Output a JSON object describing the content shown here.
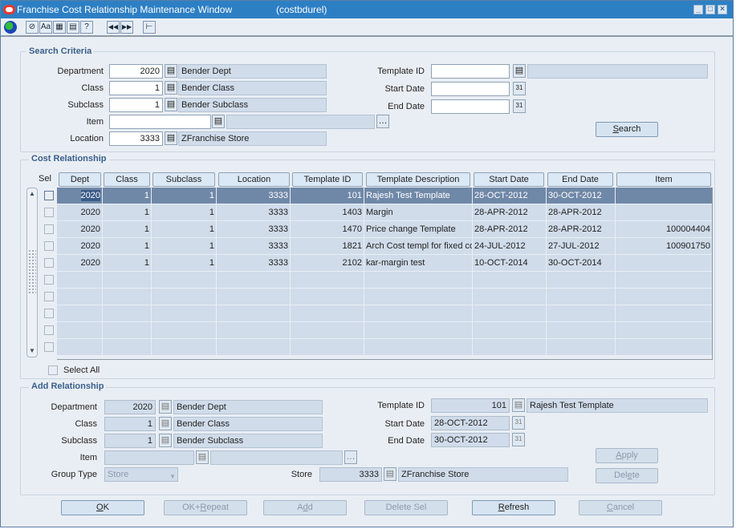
{
  "window": {
    "title": "Franchise Cost Relationship Maintenance Window",
    "module": "(costbdurel)",
    "controls": [
      "minimize",
      "maximize",
      "close"
    ]
  },
  "toolbar": {
    "icons": [
      "globe-icon",
      "exit-icon",
      "text-icon",
      "edit-icon",
      "print-icon",
      "help-icon",
      "previous-icon",
      "next-icon",
      "action-icon"
    ],
    "glyphs": {
      "exit": "⊘",
      "text": "Aa",
      "edit": "▦",
      "print": "▤",
      "help": "?",
      "prev": "◀◀",
      "next": "▶▶",
      "action": "⊢"
    }
  },
  "search_criteria": {
    "title": "Search Criteria",
    "department": {
      "label": "Department",
      "value": "2020",
      "desc": "Bender Dept"
    },
    "class": {
      "label": "Class",
      "value": "1",
      "desc": "Bender Class"
    },
    "subclass": {
      "label": "Subclass",
      "value": "1",
      "desc": "Bender Subclass"
    },
    "item": {
      "label": "Item",
      "value": "",
      "desc": ""
    },
    "location": {
      "label": "Location",
      "value": "3333",
      "desc": "ZFranchise Store"
    },
    "template_id": {
      "label": "Template ID",
      "value": "",
      "desc": ""
    },
    "start_date": {
      "label": "Start Date",
      "value": ""
    },
    "end_date": {
      "label": "End Date",
      "value": ""
    },
    "search_button": {
      "mnemonic": "S",
      "rest": "earch"
    }
  },
  "cost_relationship": {
    "title": "Cost Relationship",
    "sel_header": "Sel",
    "columns": [
      "Dept",
      "Class",
      "Subclass",
      "Location",
      "Template ID",
      "Template Description",
      "Start Date",
      "End Date",
      "Item"
    ],
    "rows": [
      {
        "dept": "2020",
        "class": "1",
        "subclass": "1",
        "location": "3333",
        "template_id": "101",
        "description": "Rajesh Test Template",
        "start": "28-OCT-2012",
        "end": "30-OCT-2012",
        "item": "",
        "selected": true
      },
      {
        "dept": "2020",
        "class": "1",
        "subclass": "1",
        "location": "3333",
        "template_id": "1403",
        "description": "Margin",
        "start": "28-APR-2012",
        "end": "28-APR-2012",
        "item": "",
        "selected": false
      },
      {
        "dept": "2020",
        "class": "1",
        "subclass": "1",
        "location": "3333",
        "template_id": "1470",
        "description": "Price change Template",
        "start": "28-APR-2012",
        "end": "28-APR-2012",
        "item": "100004404",
        "selected": false
      },
      {
        "dept": "2020",
        "class": "1",
        "subclass": "1",
        "location": "3333",
        "template_id": "1821",
        "description": "Arch Cost templ for fixed co",
        "start": "24-JUL-2012",
        "end": "27-JUL-2012",
        "item": "100901750",
        "selected": false
      },
      {
        "dept": "2020",
        "class": "1",
        "subclass": "1",
        "location": "3333",
        "template_id": "2102",
        "description": "kar-margin test",
        "start": "10-OCT-2014",
        "end": "30-OCT-2014",
        "item": "",
        "selected": false
      },
      {
        "dept": "",
        "class": "",
        "subclass": "",
        "location": "",
        "template_id": "",
        "description": "",
        "start": "",
        "end": "",
        "item": "",
        "selected": false
      },
      {
        "dept": "",
        "class": "",
        "subclass": "",
        "location": "",
        "template_id": "",
        "description": "",
        "start": "",
        "end": "",
        "item": "",
        "selected": false
      },
      {
        "dept": "",
        "class": "",
        "subclass": "",
        "location": "",
        "template_id": "",
        "description": "",
        "start": "",
        "end": "",
        "item": "",
        "selected": false
      },
      {
        "dept": "",
        "class": "",
        "subclass": "",
        "location": "",
        "template_id": "",
        "description": "",
        "start": "",
        "end": "",
        "item": "",
        "selected": false
      },
      {
        "dept": "",
        "class": "",
        "subclass": "",
        "location": "",
        "template_id": "",
        "description": "",
        "start": "",
        "end": "",
        "item": "",
        "selected": false
      }
    ],
    "select_all_label": "Select All"
  },
  "add_relationship": {
    "title": "Add Relationship",
    "department": {
      "label": "Department",
      "value": "2020",
      "desc": "Bender Dept"
    },
    "class": {
      "label": "Class",
      "value": "1",
      "desc": "Bender Class"
    },
    "subclass": {
      "label": "Subclass",
      "value": "1",
      "desc": "Bender Subclass"
    },
    "item": {
      "label": "Item",
      "value": "",
      "desc": ""
    },
    "group_type": {
      "label": "Group Type",
      "value": "Store"
    },
    "store": {
      "label": "Store",
      "value": "3333",
      "desc": "ZFranchise Store"
    },
    "template_id": {
      "label": "Template ID",
      "value": "101",
      "desc": "Rajesh Test Template"
    },
    "start_date": {
      "label": "Start Date",
      "value": "28-OCT-2012"
    },
    "end_date": {
      "label": "End Date",
      "value": "30-OCT-2012"
    },
    "apply_button": {
      "mnemonic": "A",
      "rest": "pply"
    },
    "delete_button": {
      "pre": "Del",
      "mnemonic": "e",
      "rest": "te"
    }
  },
  "footer_buttons": {
    "ok": {
      "mnemonic": "O",
      "rest": "K",
      "enabled": true
    },
    "ok_repeat": {
      "pre": "OK+",
      "mnemonic": "R",
      "rest": "epeat",
      "enabled": false
    },
    "add": {
      "pre": "A",
      "mnemonic": "d",
      "rest": "d",
      "enabled": false
    },
    "delete_sel": {
      "label": "Delete Sel",
      "enabled": false
    },
    "refresh": {
      "mnemonic": "R",
      "rest": "efresh",
      "enabled": true
    },
    "cancel": {
      "mnemonic": "C",
      "rest": "ancel",
      "enabled": false
    }
  }
}
